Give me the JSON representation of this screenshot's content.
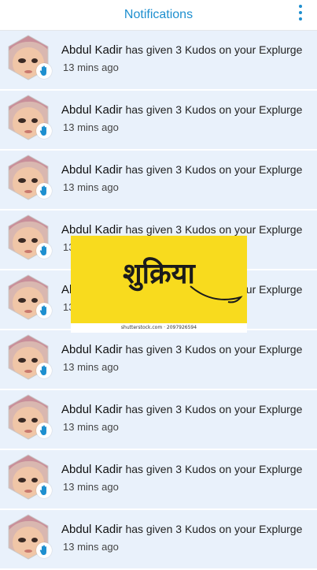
{
  "header": {
    "title": "Notifications",
    "menu_icon": "more-vertical-icon"
  },
  "notifications": [
    {
      "name": "Abdul Kadir",
      "message": "has given 3 Kudos on your Explurge",
      "time": "13 mins ago"
    },
    {
      "name": "Abdul Kadir",
      "message": "has given 3 Kudos on your Explurge",
      "time": "13 mins ago"
    },
    {
      "name": "Abdul Kadir",
      "message": "has given 3 Kudos on your Explurge",
      "time": "13 mins ago"
    },
    {
      "name": "Abdul Kadir",
      "message": "has given 3 Kudos on your Explurge",
      "time": "13 mins ago"
    },
    {
      "name": "Abdul Kadir",
      "message": "has given 3 Kudos on your Explurge",
      "time": "13 mins ago"
    },
    {
      "name": "Abdul Kadir",
      "message": "has given 3 Kudos on your Explurge",
      "time": "13 mins ago"
    },
    {
      "name": "Abdul Kadir",
      "message": "has given 3 Kudos on your Explurge",
      "time": "13 mins ago"
    },
    {
      "name": "Abdul Kadir",
      "message": "has given 3 Kudos on your Explurge",
      "time": "13 mins ago"
    },
    {
      "name": "Abdul Kadir",
      "message": "has given 3 Kudos on your Explurge",
      "time": "13 mins ago"
    }
  ],
  "overlay": {
    "text": "शुक्रिया",
    "watermark": "shutterstock.com · 2097926594"
  },
  "colors": {
    "accent": "#1e8fcf",
    "item_background": "#e9f1fb",
    "overlay_background": "#f8db1e"
  }
}
